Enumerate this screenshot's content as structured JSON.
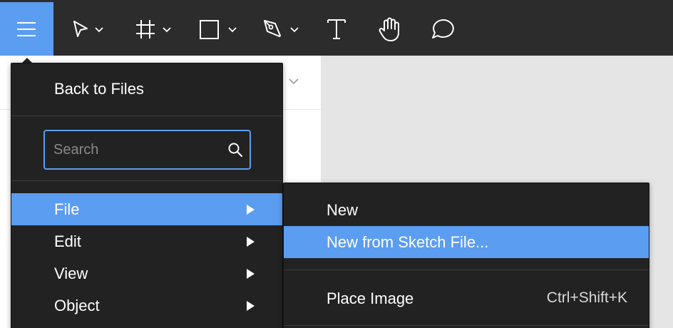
{
  "toolbar": {
    "tools": [
      "menu-icon",
      "move-tool-icon",
      "frame-tool-icon",
      "shape-tool-icon",
      "pen-tool-icon",
      "text-tool-icon",
      "hand-tool-icon",
      "comment-tool-icon"
    ]
  },
  "main_menu": {
    "back_label": "Back to Files",
    "search_placeholder": "Search",
    "items": [
      {
        "label": "File"
      },
      {
        "label": "Edit"
      },
      {
        "label": "View"
      },
      {
        "label": "Object"
      }
    ]
  },
  "submenu": {
    "items": [
      {
        "label": "New",
        "shortcut": ""
      },
      {
        "label": "New from Sketch File...",
        "shortcut": ""
      },
      {
        "label": "Place Image",
        "shortcut": "Ctrl+Shift+K"
      }
    ]
  },
  "colors": {
    "accent": "#5b9df0",
    "toolbar_bg": "#2c2c2c",
    "menu_bg": "#222222",
    "canvas_bg": "#e5e5e5"
  }
}
